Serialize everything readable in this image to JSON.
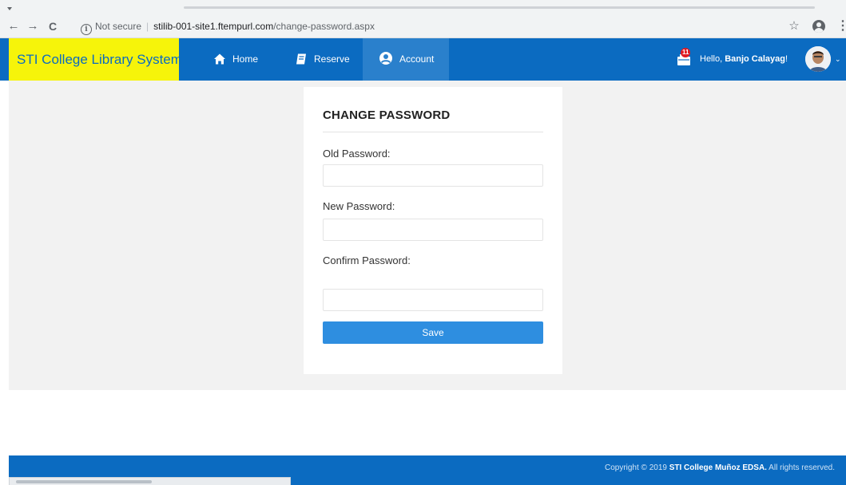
{
  "browser": {
    "back_glyph": "←",
    "forward_glyph": "→",
    "reload_glyph": "C",
    "info_glyph": "i",
    "security_text": "Not secure",
    "separator": "|",
    "url_host": "stilib-001-site1.ftempurl.com",
    "url_path": "/change-password.aspx",
    "star_glyph": "☆",
    "menu_glyph": "⋮"
  },
  "navbar": {
    "brand": "STI College Library System",
    "links": [
      {
        "label": "Home",
        "icon": "home-icon"
      },
      {
        "label": "Reserve",
        "icon": "book-icon"
      },
      {
        "label": "Account",
        "icon": "user-circle-icon",
        "active": true
      }
    ],
    "cart_badge": "11",
    "greeting_prefix": "Hello, ",
    "user_name": "Banjo Calayag",
    "greeting_suffix": "!",
    "caret": "⌄"
  },
  "form": {
    "title": "CHANGE PASSWORD",
    "old_password_label": "Old Password:",
    "new_password_label": "New Password:",
    "confirm_password_label": "Confirm Password:",
    "old_password_value": "",
    "new_password_value": "",
    "confirm_password_value": "",
    "save_label": "Save"
  },
  "footer": {
    "copyright_prefix": "Copyright © 2019 ",
    "copyright_org": "STI College Muñoz EDSA.",
    "copyright_suffix": " All rights reserved."
  },
  "colors": {
    "navbar": "#0b6bc1",
    "brand_bg": "#f6f40a",
    "active_tab": "#2a80cc",
    "save_button": "#2e8ee0",
    "badge": "#e11b22",
    "content_bg": "#f2f2f2"
  }
}
